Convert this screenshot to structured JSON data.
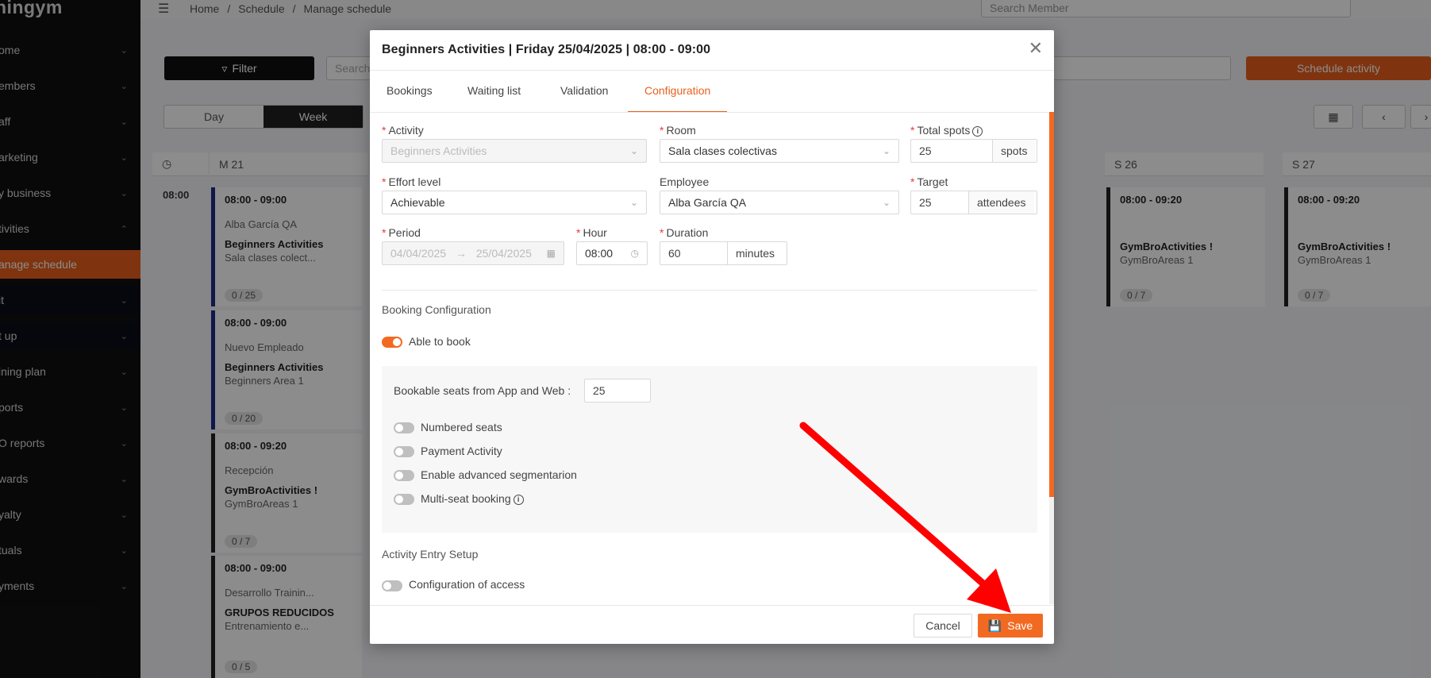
{
  "brand": "ningym",
  "sidebar": {
    "items": [
      {
        "label": "ome"
      },
      {
        "label": "embers"
      },
      {
        "label": "aff"
      },
      {
        "label": "arketing"
      },
      {
        "label": "y business"
      },
      {
        "label": "tivities"
      },
      {
        "label": "anage schedule"
      },
      {
        "label": "it"
      },
      {
        "label": "t up"
      },
      {
        "label": "ining plan"
      },
      {
        "label": "ports"
      },
      {
        "label": "O reports"
      },
      {
        "label": "wards"
      },
      {
        "label": "yalty"
      },
      {
        "label": "tuals"
      },
      {
        "label": "yments"
      }
    ]
  },
  "breadcrumb": {
    "home": "Home",
    "sep": "/",
    "schedule": "Schedule",
    "current": "Manage schedule"
  },
  "search_member": {
    "placeholder": "Search Member"
  },
  "toolbar": {
    "filter": "Filter",
    "search": "Search",
    "schedule_activity": "Schedule activity"
  },
  "view": {
    "day": "Day",
    "week": "Week"
  },
  "calendar": {
    "columns": [
      "M 21",
      "S 26",
      "S 27"
    ],
    "time": "08:00",
    "cards": [
      {
        "time": "08:00 - 09:00",
        "person": "Alba García QA",
        "name": "Beginners Activities",
        "area": "Sala clases colect...",
        "count": "0 / 25"
      },
      {
        "time": "08:00 - 09:00",
        "person": "Nuevo Empleado",
        "name": "Beginners Activities",
        "area": "Beginners Area 1",
        "count": "0 / 20"
      },
      {
        "time": "08:00 - 09:20",
        "person": "Recepción",
        "name": "GymBroActivities !",
        "area": "GymBroAreas 1",
        "count": "0 / 7"
      },
      {
        "time": "08:00 - 09:00",
        "person": "Desarrollo Trainin...",
        "name": "GRUPOS REDUCIDOS",
        "area": "Entrenamiento e...",
        "count": "0 / 5"
      },
      {
        "time": "08:00 - 09:20",
        "person": "",
        "name": "GymBroActivities !",
        "area": "GymBroAreas 1",
        "count": "0 / 7"
      },
      {
        "time": "08:00 - 09:20",
        "person": "",
        "name": "GymBroActivities !",
        "area": "GymBroAreas 1",
        "count": "0 / 7"
      }
    ]
  },
  "modal": {
    "title": "Beginners Activities | Friday 25/04/2025 | 08:00 - 09:00",
    "tabs": [
      "Bookings",
      "Waiting list",
      "Validation",
      "Configuration"
    ],
    "active_tab": "Configuration",
    "fields": {
      "activity": {
        "label": "Activity",
        "value": "Beginners Activities"
      },
      "room": {
        "label": "Room",
        "value": "Sala clases colectivas"
      },
      "total_spots": {
        "label": "Total spots",
        "value": "25",
        "unit": "spots"
      },
      "effort_level": {
        "label": "Effort level",
        "value": "Achievable"
      },
      "employee": {
        "label": "Employee",
        "value": "Alba García QA"
      },
      "target": {
        "label": "Target",
        "value": "25",
        "unit": "attendees"
      },
      "period": {
        "label": "Period",
        "start": "04/04/2025",
        "end": "25/04/2025",
        "arrow": "→"
      },
      "hour": {
        "label": "Hour",
        "value": "08:00"
      },
      "duration": {
        "label": "Duration",
        "value": "60",
        "unit": "minutes"
      }
    },
    "booking": {
      "section_title": "Booking Configuration",
      "able_to_book": "Able to book",
      "bookable_seats_label": "Bookable seats from App and Web :",
      "bookable_seats_value": "25",
      "numbered_seats": "Numbered seats",
      "payment_activity": "Payment Activity",
      "advanced_segmentation": "Enable advanced segmentarion",
      "multi_seat": "Multi-seat booking"
    },
    "entry": {
      "section_title": "Activity Entry Setup",
      "config_access": "Configuration of access"
    },
    "cancel": "Cancel",
    "save": "Save"
  },
  "colors": {
    "accent": "#f26a22",
    "arrow": "#ff0000"
  }
}
